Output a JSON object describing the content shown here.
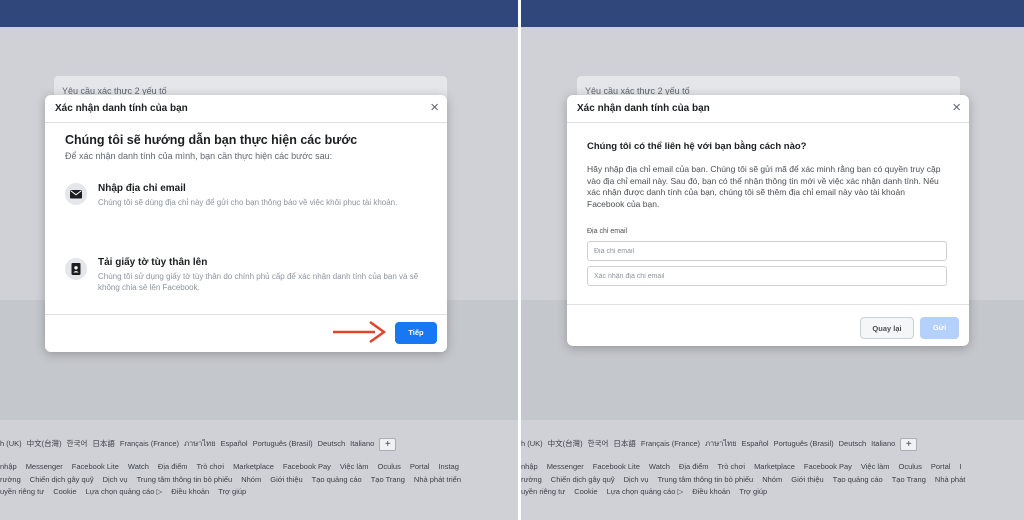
{
  "background": {
    "card_label": "Yêu cầu xác thực 2 yếu tố"
  },
  "footer": {
    "languages_left": [
      "h (UK)",
      "中文(台灣)",
      "한국어",
      "日本語",
      "Français (France)",
      "ภาษาไทย",
      "Español",
      "Português (Brasil)",
      "Deutsch",
      "Italiano"
    ],
    "languages_right": [
      "h (UK)",
      "中文(台灣)",
      "한국어",
      "日本語",
      "Français (France)",
      "ภาษาไทย",
      "Español",
      "Português (Brasil)",
      "Deutsch",
      "Italiano"
    ],
    "plus_label": "+",
    "links_left": [
      "nhập",
      "Messenger",
      "Facebook Lite",
      "Watch",
      "Địa điểm",
      "Trò chơi",
      "Marketplace",
      "Facebook Pay",
      "Việc làm",
      "Oculus",
      "Portal",
      "Instag",
      "rường",
      "Chiến dịch gây quỹ",
      "Dịch vụ",
      "Trung tâm thông tin bỏ phiếu",
      "Nhóm",
      "Giới thiệu",
      "Tạo quảng cáo",
      "Tạo Trang",
      "Nhà phát triển",
      "uyền riêng tư",
      "Cookie",
      "Lựa chọn quảng cáo ▷",
      "Điều khoản",
      "Trợ giúp"
    ],
    "links_right": [
      "nhập",
      "Messenger",
      "Facebook Lite",
      "Watch",
      "Địa điểm",
      "Trò chơi",
      "Marketplace",
      "Facebook Pay",
      "Việc làm",
      "Oculus",
      "Portal",
      "I",
      "rường",
      "Chiến dịch gây quỹ",
      "Dịch vụ",
      "Trung tâm thông tin bỏ phiếu",
      "Nhóm",
      "Giới thiệu",
      "Tạo quảng cáo",
      "Tạo Trang",
      "Nhà phát",
      "uyền riêng tư",
      "Cookie",
      "Lựa chọn quảng cáo ▷",
      "Điều khoản",
      "Trợ giúp"
    ]
  },
  "modal_left": {
    "title": "Xác nhận danh tính của bạn",
    "close_icon": "×",
    "heading": "Chúng tôi sẽ hướng dẫn bạn thực hiện các bước",
    "subheading": "Để xác nhận danh tính của mình, bạn cần thực hiện các bước sau:",
    "steps": [
      {
        "icon": "envelope-icon",
        "title": "Nhập địa chỉ email",
        "desc": "Chúng tôi sẽ dùng địa chỉ này để gửi cho bạn thông báo về việc khôi phục tài khoản."
      },
      {
        "icon": "id-card-icon",
        "title": "Tải giấy tờ tùy thân lên",
        "desc": "Chúng tôi sử dụng giấy tờ tùy thân do chính phủ cấp để xác nhận danh tính của bạn và sẽ không chia sẻ lên Facebook."
      }
    ],
    "next_label": "Tiếp",
    "accent": "#1877f2",
    "arrow_color": "#e0452c"
  },
  "modal_right": {
    "title": "Xác nhận danh tính của bạn",
    "close_icon": "×",
    "question": "Chúng tôi có thể liên hệ với bạn bằng cách nào?",
    "description": "Hãy nhập địa chỉ email của bạn. Chúng tôi sẽ gửi mã để xác minh rằng bạn có quyền truy cập vào địa chỉ email này. Sau đó, bạn có thể nhận thông tin mới về việc xác nhận danh tính. Nếu xác nhận được danh tính của bạn, chúng tôi sẽ thêm địa chỉ email này vào tài khoản Facebook của bạn.",
    "email_label": "Địa chỉ email",
    "email_placeholder": "Địa chỉ email",
    "confirm_placeholder": "Xác nhận địa chỉ email",
    "back_label": "Quay lại",
    "send_label": "Gửi",
    "send_disabled_color": "#b3d1fb"
  }
}
